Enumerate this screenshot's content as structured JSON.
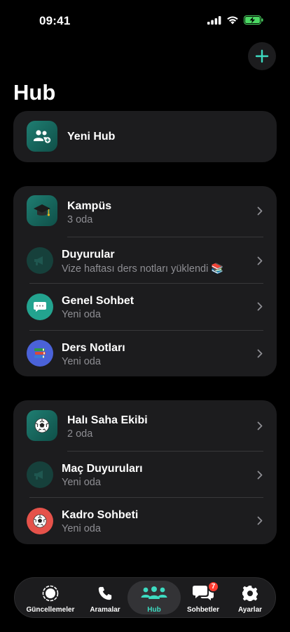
{
  "status": {
    "time": "09:41"
  },
  "page": {
    "title": "Hub"
  },
  "new_hub": {
    "label": "Yeni Hub"
  },
  "groups": [
    {
      "header": {
        "title": "Kampüs",
        "subtitle": "3 oda",
        "icon": "graduation-cap-icon"
      },
      "rooms": [
        {
          "title": "Duyurular",
          "subtitle": "Vize haftası ders notları yüklendi 📚",
          "icon": "megaphone-icon",
          "color": "#16403b"
        },
        {
          "title": "Genel Sohbet",
          "subtitle": "Yeni oda",
          "icon": "speech-bubble-icon",
          "color": "#23a38f"
        },
        {
          "title": "Ders Notları",
          "subtitle": "Yeni oda",
          "icon": "books-icon",
          "color": "#4a62d8"
        }
      ]
    },
    {
      "header": {
        "title": "Halı Saha Ekibi",
        "subtitle": "2 oda",
        "icon": "soccer-ball-icon"
      },
      "rooms": [
        {
          "title": "Maç Duyuruları",
          "subtitle": "Yeni oda",
          "icon": "megaphone-icon",
          "color": "#16403b"
        },
        {
          "title": "Kadro Sohbeti",
          "subtitle": "Yeni oda",
          "icon": "soccer-ball-icon",
          "color": "#e5524a"
        }
      ]
    }
  ],
  "tabs": [
    {
      "label": "Güncellemeler",
      "icon": "updates-icon"
    },
    {
      "label": "Aramalar",
      "icon": "phone-icon"
    },
    {
      "label": "Hub",
      "icon": "people-icon",
      "active": true
    },
    {
      "label": "Sohbetler",
      "icon": "chats-icon",
      "badge": "7"
    },
    {
      "label": "Ayarlar",
      "icon": "gear-icon"
    }
  ],
  "colors": {
    "accent": "#3ddbc1",
    "card": "#1c1c1e",
    "badge": "#ff3b30",
    "secondary_text": "#8e8e93"
  }
}
